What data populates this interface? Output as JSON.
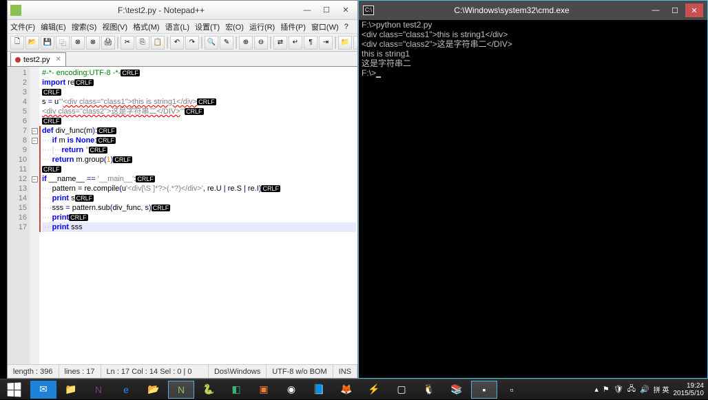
{
  "npp": {
    "title": "F:\\test2.py - Notepad++",
    "menu": [
      "文件(F)",
      "编辑(E)",
      "搜索(S)",
      "视图(V)",
      "格式(M)",
      "语言(L)",
      "设置(T)",
      "宏(O)",
      "运行(R)",
      "插件(P)",
      "窗口(W)",
      "?"
    ],
    "tab": {
      "label": "test2.py"
    },
    "status": {
      "length": "length : 396",
      "lines": "lines : 17",
      "pos": "Ln : 17    Col : 14    Sel : 0 | 0",
      "eol": "Dos\\Windows",
      "enc": "UTF-8 w/o BOM",
      "mode": "INS"
    },
    "code": [
      {
        "n": "1",
        "pre": "",
        "segs": [
          {
            "t": "#-*- encoding:UTF-8 -*-",
            "c": "com"
          }
        ],
        "crlf": true
      },
      {
        "n": "2",
        "pre": "",
        "segs": [
          {
            "t": "import ",
            "c": "kw"
          },
          {
            "t": "re",
            "c": "id"
          }
        ],
        "crlf": true
      },
      {
        "n": "3",
        "pre": "",
        "segs": [],
        "crlf": true
      },
      {
        "n": "4",
        "pre": "",
        "segs": [
          {
            "t": "s ",
            "c": "id"
          },
          {
            "t": "= ",
            "c": "op"
          },
          {
            "t": "u",
            "c": "id"
          },
          {
            "t": "'''",
            "c": "str"
          },
          {
            "t": "<div class=\"class1\">this is string1</div>",
            "c": "str wavy"
          }
        ],
        "crlf": true
      },
      {
        "n": "5",
        "pre": "",
        "segs": [
          {
            "t": "<div class=\"class2\">这是字符串二</DIV>",
            "c": "str wavy"
          },
          {
            "t": "'''",
            "c": "str"
          }
        ],
        "crlf": true
      },
      {
        "n": "6",
        "pre": "",
        "segs": [],
        "crlf": true
      },
      {
        "n": "7",
        "pre": "",
        "segs": [
          {
            "t": "def ",
            "c": "kw"
          },
          {
            "t": "div_func",
            "c": "id"
          },
          {
            "t": "(",
            "c": "op"
          },
          {
            "t": "m",
            "c": "id"
          },
          {
            "t": ")",
            "c": "op"
          },
          {
            "t": ":",
            "c": "op"
          }
        ],
        "crlf": true,
        "fold": "-"
      },
      {
        "n": "8",
        "pre": "····",
        "segs": [
          {
            "t": "if ",
            "c": "kw"
          },
          {
            "t": "m ",
            "c": "id"
          },
          {
            "t": "is ",
            "c": "kw"
          },
          {
            "t": "None",
            "c": "kw"
          },
          {
            "t": ":",
            "c": "op"
          }
        ],
        "crlf": true,
        "fold": "-"
      },
      {
        "n": "9",
        "pre": "····|···",
        "segs": [
          {
            "t": "return ",
            "c": "kw"
          },
          {
            "t": "''",
            "c": "str"
          }
        ],
        "crlf": true
      },
      {
        "n": "10",
        "pre": "····",
        "segs": [
          {
            "t": "return ",
            "c": "kw"
          },
          {
            "t": "m",
            "c": "id"
          },
          {
            "t": ".",
            "c": "op"
          },
          {
            "t": "group",
            "c": "fn"
          },
          {
            "t": "(",
            "c": "op"
          },
          {
            "t": "1",
            "c": "num"
          },
          {
            "t": ")",
            "c": "op"
          }
        ],
        "crlf": true
      },
      {
        "n": "11",
        "pre": "",
        "segs": [],
        "crlf": true
      },
      {
        "n": "12",
        "pre": "",
        "segs": [
          {
            "t": "if ",
            "c": "kw"
          },
          {
            "t": "__name__ ",
            "c": "id"
          },
          {
            "t": "== ",
            "c": "op"
          },
          {
            "t": "'__main__'",
            "c": "str"
          },
          {
            "t": ":",
            "c": "op"
          }
        ],
        "crlf": true,
        "fold": "-"
      },
      {
        "n": "13",
        "pre": "····",
        "segs": [
          {
            "t": "pattern ",
            "c": "id"
          },
          {
            "t": "= ",
            "c": "op"
          },
          {
            "t": "re",
            "c": "id"
          },
          {
            "t": ".",
            "c": "op"
          },
          {
            "t": "compile",
            "c": "fn"
          },
          {
            "t": "(",
            "c": "op"
          },
          {
            "t": "u",
            "c": "id"
          },
          {
            "t": "'<div[\\S ]*?>(.*?)</div>'",
            "c": "str"
          },
          {
            "t": ", ",
            "c": "op"
          },
          {
            "t": "re",
            "c": "id"
          },
          {
            "t": ".",
            "c": "op"
          },
          {
            "t": "U ",
            "c": "id"
          },
          {
            "t": "| ",
            "c": "op"
          },
          {
            "t": "re",
            "c": "id"
          },
          {
            "t": ".",
            "c": "op"
          },
          {
            "t": "S ",
            "c": "id"
          },
          {
            "t": "| ",
            "c": "op"
          },
          {
            "t": "re",
            "c": "id"
          },
          {
            "t": ".",
            "c": "op"
          },
          {
            "t": "I",
            "c": "id"
          },
          {
            "t": ")",
            "c": "op"
          }
        ],
        "crlf": true
      },
      {
        "n": "14",
        "pre": "····",
        "segs": [
          {
            "t": "print ",
            "c": "kw"
          },
          {
            "t": "s",
            "c": "id"
          }
        ],
        "crlf": true
      },
      {
        "n": "15",
        "pre": "····",
        "segs": [
          {
            "t": "sss ",
            "c": "id"
          },
          {
            "t": "= ",
            "c": "op"
          },
          {
            "t": "pattern",
            "c": "id"
          },
          {
            "t": ".",
            "c": "op"
          },
          {
            "t": "sub",
            "c": "fn"
          },
          {
            "t": "(",
            "c": "op"
          },
          {
            "t": "div_func",
            "c": "id"
          },
          {
            "t": ", ",
            "c": "op"
          },
          {
            "t": "s",
            "c": "id"
          },
          {
            "t": ")",
            "c": "op"
          }
        ],
        "crlf": true
      },
      {
        "n": "16",
        "pre": "····",
        "segs": [
          {
            "t": "print",
            "c": "kw"
          }
        ],
        "crlf": true
      },
      {
        "n": "17",
        "pre": "····",
        "segs": [
          {
            "t": "print ",
            "c": "kw"
          },
          {
            "t": "sss",
            "c": "id"
          }
        ],
        "crlf": false,
        "current": true
      }
    ]
  },
  "cmd": {
    "title": "C:\\Windows\\system32\\cmd.exe",
    "lines": [
      "F:\\>python test2.py",
      "<div class=\"class1\">this is string1</div>",
      "<div class=\"class2\">这是字符串二</DIV>",
      "",
      "this is string1",
      "这是字符串二",
      "",
      "F:\\>"
    ]
  },
  "tray": {
    "time": "19:24",
    "date": "2015/5/10",
    "ime": "拼 英"
  }
}
